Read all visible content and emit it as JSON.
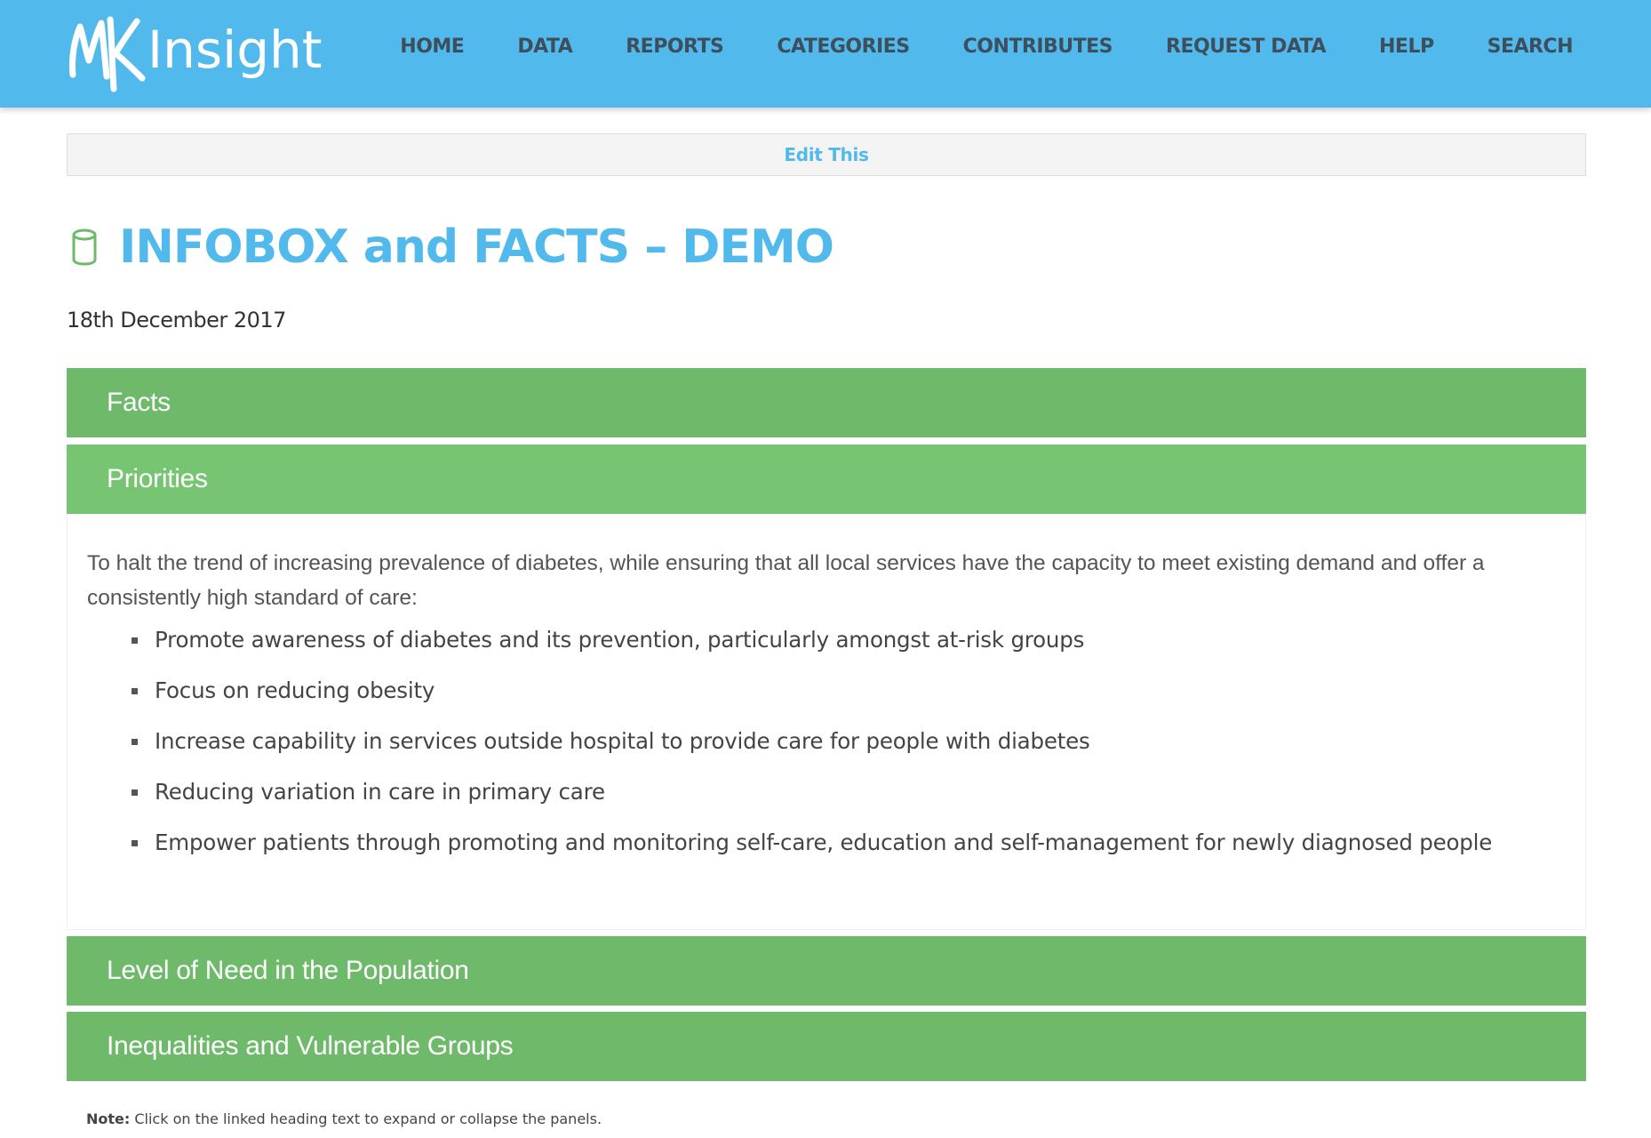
{
  "header": {
    "logo_text": "Insight",
    "nav": [
      {
        "label": "HOME"
      },
      {
        "label": "DATA"
      },
      {
        "label": "REPORTS"
      },
      {
        "label": "CATEGORIES"
      },
      {
        "label": "CONTRIBUTES"
      },
      {
        "label": "REQUEST DATA"
      },
      {
        "label": "HELP"
      },
      {
        "label": "SEARCH"
      }
    ]
  },
  "edit_bar": {
    "label": "Edit This"
  },
  "page": {
    "title_icon": "database-icon",
    "title": "INFOBOX and FACTS – DEMO",
    "date": "18th December 2017"
  },
  "panels": [
    {
      "label": "Facts",
      "expanded": false
    },
    {
      "label": "Priorities",
      "expanded": true
    },
    {
      "label": "Level of Need in the Population",
      "expanded": false
    },
    {
      "label": "Inequalities and Vulnerable Groups",
      "expanded": false
    }
  ],
  "priorities": {
    "intro": "To halt the trend of increasing prevalence of diabetes, while ensuring that all local services have the capacity to meet existing demand and offer a consistently high standard of care:",
    "items": [
      "Promote awareness of diabetes and its prevention, particularly amongst at-risk groups",
      "Focus on reducing obesity",
      "Increase capability in services outside hospital to provide care for people with diabetes",
      "Reducing variation in care in primary care",
      "Empower patients through promoting and monitoring self-care, education and self-management for newly diagnosed people"
    ]
  },
  "note": {
    "label": "Note:",
    "text": " Click on the linked heading text to expand or collapse the panels."
  },
  "colors": {
    "header_bg": "#52b9ec",
    "nav_text": "#3d4f5c",
    "title_blue": "#52b9ec",
    "panel_green": "#6fb96b",
    "panel_green_open": "#77c572",
    "icon_green": "#6fb96b"
  }
}
